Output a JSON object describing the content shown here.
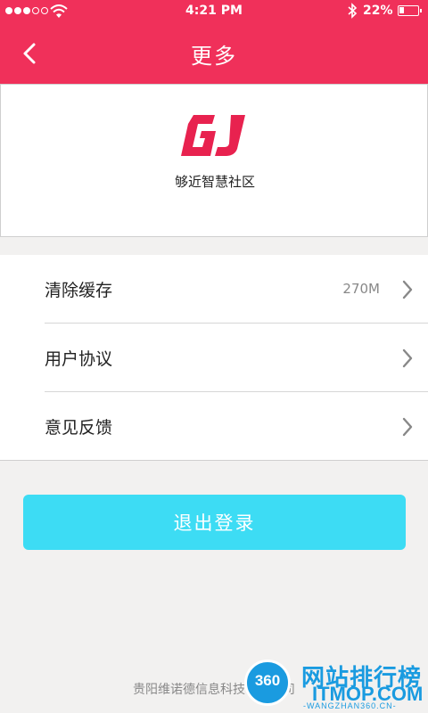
{
  "status_bar": {
    "time": "4:21 PM",
    "battery": "22%",
    "signal_bars": 3,
    "signal_total": 5
  },
  "nav": {
    "title": "更多",
    "back_icon": "chevron-left-icon"
  },
  "logo": {
    "mark": "GJ",
    "text": "够近智慧社区",
    "color": "#e8224f"
  },
  "menu": {
    "items": [
      {
        "label": "清除缓存",
        "value": "270M"
      },
      {
        "label": "用户协议",
        "value": ""
      },
      {
        "label": "意见反馈",
        "value": ""
      }
    ]
  },
  "logout": {
    "label": "退出登录",
    "color": "#3ddcf4"
  },
  "footer": {
    "text": "贵阳维诺德信息科技有限公司"
  },
  "watermark": {
    "badge": "360",
    "title": "网站排行榜",
    "brand": "ITMOP.COM",
    "url": "-WANGZHAN360.CN-"
  },
  "colors": {
    "accent": "#f0305a",
    "background": "#f2f1f0"
  }
}
